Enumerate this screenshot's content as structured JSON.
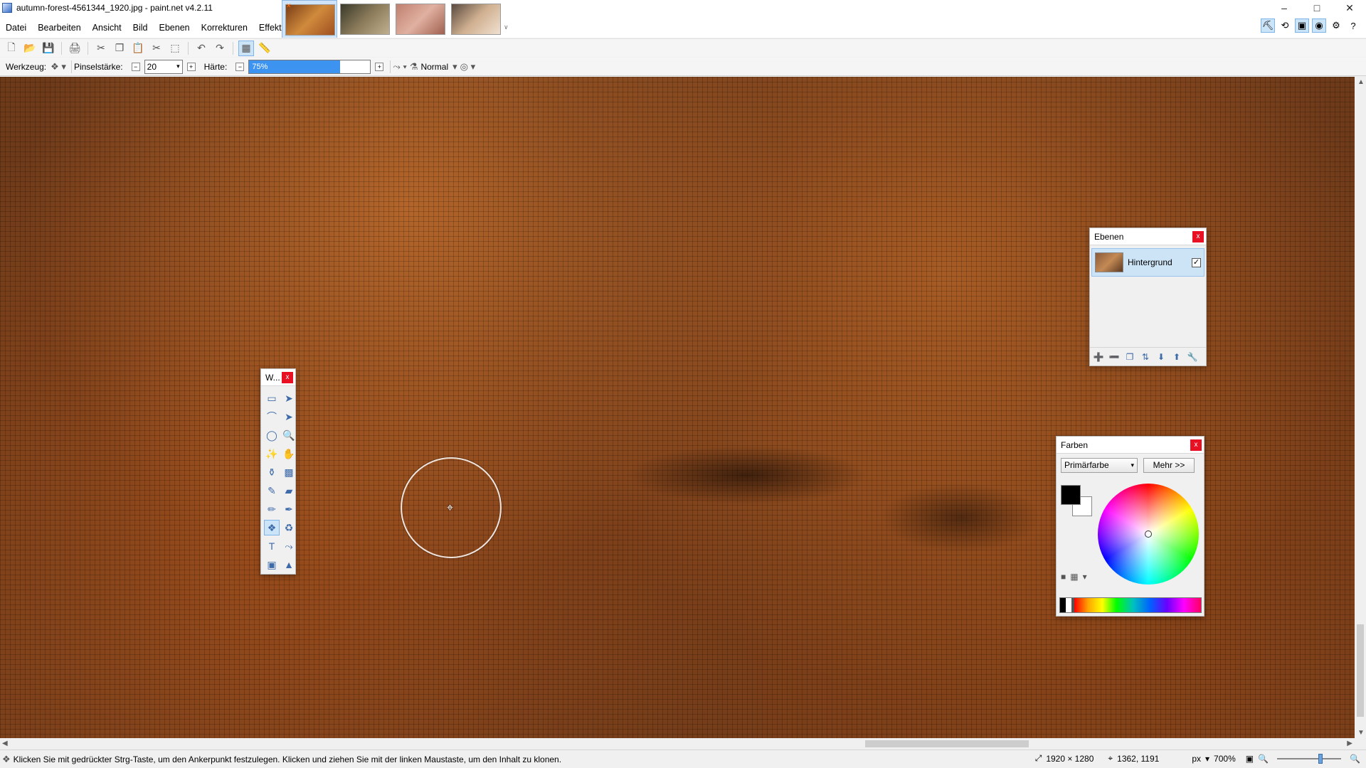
{
  "window": {
    "title": "autumn-forest-4561344_1920.jpg - paint.net v4.2.11",
    "controls": {
      "minimize": "–",
      "maximize": "□",
      "close": "✕"
    }
  },
  "menu": [
    "Datei",
    "Bearbeiten",
    "Ansicht",
    "Bild",
    "Ebenen",
    "Korrekturen",
    "Effekte"
  ],
  "document_tabs": {
    "close_mark": "✕",
    "dropdown": "∨",
    "thumb_colors": [
      [
        "#7a3d17",
        "#d08a3c",
        "#a05020"
      ],
      [
        "#3a3a2a",
        "#8a7a5a",
        "#c0b090"
      ],
      [
        "#c08070",
        "#e0b0a0",
        "#a06050"
      ],
      [
        "#5a4a40",
        "#d0b090",
        "#f0e0d0"
      ]
    ]
  },
  "toolbar": {
    "icons": [
      "new-file-icon",
      "open-file-icon",
      "save-icon",
      "print-icon",
      "cut-icon",
      "copy-icon",
      "paste-icon",
      "crop-icon",
      "deselect-icon",
      "undo-icon",
      "redo-icon",
      "grid-icon",
      "ruler-icon"
    ],
    "glyphs": [
      "🗋",
      "📂",
      "💾",
      "🖨",
      "✂",
      "❐",
      "📋",
      "✂",
      "⬚",
      "↶",
      "↷",
      "▦",
      "📏"
    ]
  },
  "tool_options": {
    "tool_label": "Werkzeug:",
    "brush_size_label": "Pinselstärke:",
    "brush_size_value": "20",
    "hardness_label": "Härte:",
    "hardness_value": "75%",
    "hardness_percent": 75,
    "blend_mode": "Normal",
    "minus": "−",
    "plus": "+"
  },
  "tools_window": {
    "title": "W...",
    "close": "x",
    "tools": [
      {
        "name": "rectangle-select-icon",
        "glyph": "▭"
      },
      {
        "name": "move-selection-icon",
        "glyph": "➤"
      },
      {
        "name": "lasso-select-icon",
        "glyph": "⌒"
      },
      {
        "name": "move-selected-icon",
        "glyph": "➤"
      },
      {
        "name": "ellipse-select-icon",
        "glyph": "◯"
      },
      {
        "name": "zoom-icon",
        "glyph": "🔍"
      },
      {
        "name": "magic-wand-icon",
        "glyph": "✨"
      },
      {
        "name": "pan-icon",
        "glyph": "✋"
      },
      {
        "name": "paint-bucket-icon",
        "glyph": "⚱"
      },
      {
        "name": "gradient-icon",
        "glyph": "▩"
      },
      {
        "name": "paintbrush-icon",
        "glyph": "✎"
      },
      {
        "name": "eraser-icon",
        "glyph": "▰"
      },
      {
        "name": "pencil-icon",
        "glyph": "✏"
      },
      {
        "name": "color-picker-icon",
        "glyph": "✒"
      },
      {
        "name": "clone-stamp-icon",
        "glyph": "❖"
      },
      {
        "name": "recolor-icon",
        "glyph": "♻"
      },
      {
        "name": "text-icon",
        "glyph": "T"
      },
      {
        "name": "line-curve-icon",
        "glyph": "⤳"
      },
      {
        "name": "shapes-icon",
        "glyph": "▣"
      },
      {
        "name": "shape-extra-icon",
        "glyph": "▲"
      }
    ],
    "selected_index": 14
  },
  "layers_window": {
    "title": "Ebenen",
    "close": "x",
    "layer_name": "Hintergrund",
    "checked": "✓",
    "tool_glyphs": [
      "➕",
      "➖",
      "❐",
      "⇅",
      "⬇",
      "⬆",
      "🔧"
    ]
  },
  "colors_window": {
    "title": "Farben",
    "close": "x",
    "select_value": "Primärfarbe",
    "more_button": "Mehr >>",
    "primary_color": "#000000",
    "secondary_color": "#ffffff",
    "icons": [
      "■",
      "▦",
      "▾"
    ]
  },
  "status": {
    "hint": "Klicken Sie mit gedrückter Strg-Taste, um den Ankerpunkt festzulegen. Klicken und ziehen Sie mit der linken Maustaste, um den Inhalt zu klonen.",
    "image_size": "1920 × 1280",
    "cursor_pos": "1362, 1191",
    "unit": "px",
    "zoom": "700%"
  }
}
